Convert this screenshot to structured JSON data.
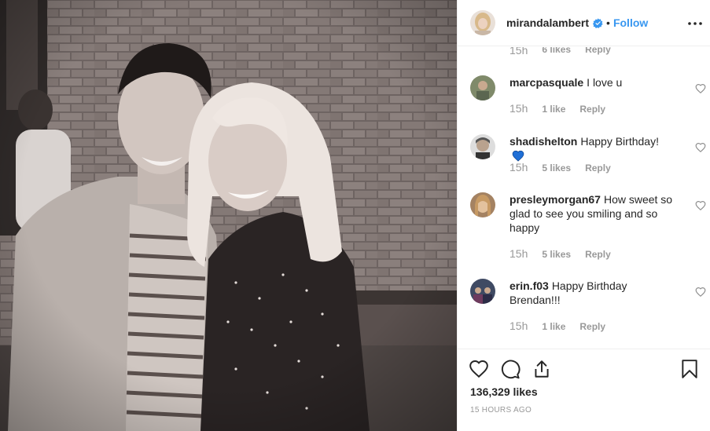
{
  "header": {
    "username": "mirandalambert",
    "separator": "•",
    "follow_label": "Follow"
  },
  "clipped_comment": {
    "time": "15h",
    "likes": "6 likes",
    "reply": "Reply"
  },
  "comments": [
    {
      "username": "marcpasquale",
      "text": "I love u",
      "time": "15h",
      "likes": "1 like",
      "reply": "Reply"
    },
    {
      "username": "shadishelton",
      "text": "Happy Birthday!",
      "emoji": "blue-heart",
      "time": "15h",
      "likes": "5 likes",
      "reply": "Reply"
    },
    {
      "username": "presleymorgan67",
      "text": "How sweet so glad to see you smiling and so happy",
      "time": "15h",
      "likes": "5 likes",
      "reply": "Reply"
    },
    {
      "username": "erin.f03",
      "text": "Happy Birthday Brendan!!!",
      "time": "15h",
      "likes": "1 like",
      "reply": "Reply"
    }
  ],
  "footer": {
    "likes_count": "136,329 likes",
    "time_ago": "15 HOURS AGO"
  },
  "icons": [
    "verified-icon",
    "more-options-icon",
    "like-heart-icon",
    "comment-icon",
    "share-icon",
    "bookmark-icon"
  ],
  "colors": {
    "accent": "#3897f0",
    "text": "#262626",
    "secondary": "#999999",
    "border": "#efefef",
    "blue_heart": "#1f6fd6"
  }
}
